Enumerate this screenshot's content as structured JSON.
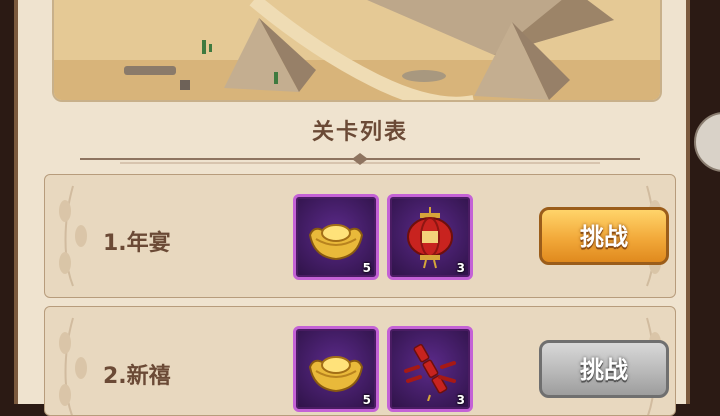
{
  "panel": {
    "title": "关卡列表"
  },
  "stages": [
    {
      "name": "1.年宴",
      "rewards": [
        {
          "item": "gold-ingot-icon",
          "count": "5"
        },
        {
          "item": "red-lantern-icon",
          "count": "3"
        }
      ],
      "button_label": "挑战",
      "button_state": "active"
    },
    {
      "name": "2.新禧",
      "rewards": [
        {
          "item": "gold-ingot-icon",
          "count": "5"
        },
        {
          "item": "firecracker-icon",
          "count": "3"
        }
      ],
      "button_label": "挑战",
      "button_state": "disabled"
    }
  ],
  "colors": {
    "active_button": "#f2a93a",
    "disabled_button": "#b9b9b9",
    "reward_frame": "#c462d6",
    "text": "#6b4a36"
  }
}
